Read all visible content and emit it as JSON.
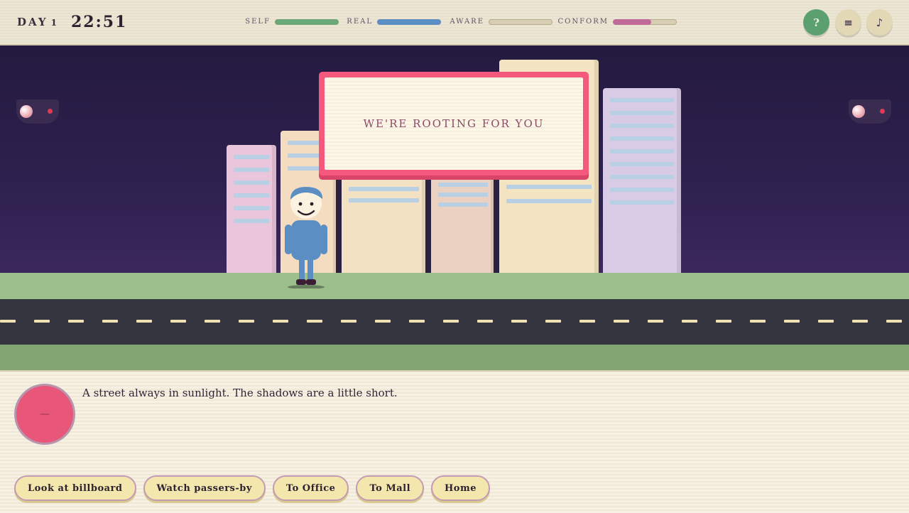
{
  "hud": {
    "day_label": "DAY",
    "day_number": "1",
    "time": "22:51",
    "stats": [
      {
        "label": "SELF",
        "value": 1.0,
        "color": "#6aa878"
      },
      {
        "label": "REAL",
        "value": 1.0,
        "color": "#5b8fc4"
      },
      {
        "label": "AWARE",
        "value": 0.0,
        "color": "#cfc1a0"
      },
      {
        "label": "CONFORM",
        "value": 0.6,
        "color": "#c06a9a"
      }
    ],
    "help_label": "?",
    "menu_label": "≡",
    "music_label": "♪"
  },
  "scene": {
    "billboard_text": "WE'RE ROOTING FOR YOU",
    "colors": {
      "billboard_frame": "#f5587d",
      "sky_top": "#241a3f",
      "sky_bottom": "#4a2f6c",
      "grass": "#9cbf8c",
      "road": "#34353f"
    }
  },
  "dialogue": {
    "portrait_label": "—",
    "text": "A street always in sunlight. The shadows are a little short."
  },
  "actions": [
    {
      "label": "Look at billboard"
    },
    {
      "label": "Watch passers-by"
    },
    {
      "label": "To Office"
    },
    {
      "label": "To Mall"
    },
    {
      "label": "Home"
    }
  ]
}
